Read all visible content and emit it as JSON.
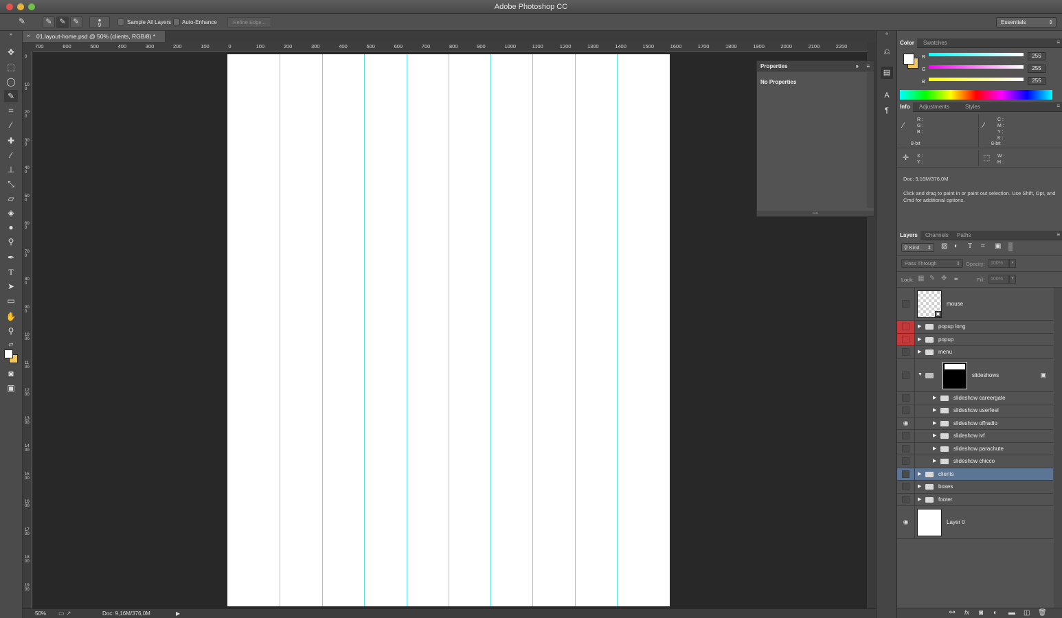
{
  "app": {
    "title": "Adobe Photoshop CC"
  },
  "colors": {
    "guide": "#5ce0ee",
    "selection": "#5c7594",
    "visibility_red": "#c23a3a",
    "foreground": "#ffffff",
    "background": "#f2c85b"
  },
  "options_bar": {
    "brush_size": "9",
    "sample_all_layers_label": "Sample All Layers",
    "auto_enhance_label": "Auto-Enhance",
    "refine_edge_label": "Refine Edge...",
    "workspace": "Essentials"
  },
  "document": {
    "tab_title": "01.layout-home.psd @ 50% (clients, RGB/8) *",
    "close_glyph": "×",
    "zoom": "50%",
    "doc_size": "Doc: 9,16M/376,0M"
  },
  "ruler": {
    "h_labels": [
      "700",
      "600",
      "500",
      "400",
      "300",
      "200",
      "100",
      "0",
      "100",
      "200",
      "300",
      "400",
      "500",
      "600",
      "700",
      "800",
      "900",
      "1000",
      "1100",
      "1200",
      "1300",
      "1400",
      "1500",
      "1600",
      "1700",
      "1800",
      "1900",
      "2000",
      "2100",
      "2200"
    ],
    "v_labels": [
      "0",
      "100",
      "200",
      "300",
      "400",
      "500",
      "600",
      "700",
      "800",
      "900",
      "1000",
      "1100",
      "1200",
      "1300",
      "1400",
      "1500",
      "1600",
      "1700",
      "1800",
      "1900"
    ]
  },
  "properties": {
    "title": "Properties",
    "body": "No Properties"
  },
  "color_panel": {
    "tabs": [
      "Color",
      "Swatches"
    ],
    "r_label": "R",
    "g_label": "G",
    "b_label": "B",
    "r": "255",
    "g": "255",
    "b": "255"
  },
  "info_panel": {
    "tabs": [
      "Info",
      "Adjustments",
      "Styles"
    ],
    "rgb_labels": "R :\nG :\nB :",
    "cmyk_labels": "C :\nM :\nY :\nK :",
    "bit_left": "8-bit",
    "bit_right": "8-bit",
    "xy_labels": "X :\nY :",
    "wh_labels": "W :\nH :",
    "doc": "Doc: 9,16M/376,0M",
    "hint": "Click and drag to paint in or paint out selection.  Use Shift, Opt, and Cmd for additional options."
  },
  "layers_panel": {
    "tabs": [
      "Layers",
      "Channels",
      "Paths"
    ],
    "filter_kind": "Kind",
    "blend_mode": "Pass Through",
    "opacity_label": "Opacity:",
    "opacity_value": "100%",
    "lock_label": "Lock:",
    "fill_label": "Fill:",
    "fill_value": "100%",
    "layers": [
      {
        "name": "mouse",
        "kind": "smart",
        "eye": "none"
      },
      {
        "name": "popup long",
        "kind": "group",
        "eye": "red"
      },
      {
        "name": "popup",
        "kind": "group",
        "eye": "red"
      },
      {
        "name": "menu",
        "kind": "group",
        "eye": "none"
      },
      {
        "name": "slideshows",
        "kind": "group-open-mask",
        "eye": "none"
      },
      {
        "name": "slideshow careergate",
        "kind": "group",
        "eye": "none",
        "indent": true
      },
      {
        "name": "slideshow userfeel",
        "kind": "group",
        "eye": "none",
        "indent": true
      },
      {
        "name": "slideshow offradio",
        "kind": "group",
        "eye": "visible",
        "indent": true
      },
      {
        "name": "slideshow ivf",
        "kind": "group",
        "eye": "none",
        "indent": true
      },
      {
        "name": "slideshow parachute",
        "kind": "group",
        "eye": "none",
        "indent": true
      },
      {
        "name": "slideshow chicco",
        "kind": "group",
        "eye": "none",
        "indent": true
      },
      {
        "name": "clients",
        "kind": "group",
        "eye": "none",
        "selected": true
      },
      {
        "name": "boxes",
        "kind": "group",
        "eye": "none"
      },
      {
        "name": "footer",
        "kind": "group",
        "eye": "none"
      },
      {
        "name": "Layer 0",
        "kind": "pixel",
        "eye": "visible"
      }
    ]
  }
}
